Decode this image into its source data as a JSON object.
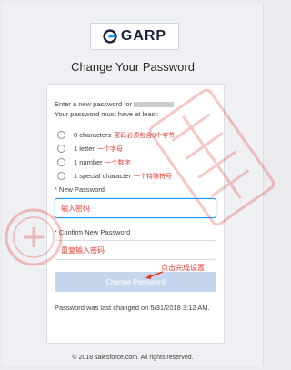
{
  "brand": {
    "logo_text": "GARP",
    "accent": "#1b96ff",
    "annotation_color": "#e23b2e"
  },
  "page": {
    "title": "Change Your Password"
  },
  "intro": {
    "line1": "Enter a new password for",
    "line2": "Your password must have at least:"
  },
  "requirements": [
    {
      "label": "8 characters",
      "note": "密码必须包含8个字节"
    },
    {
      "label": "1 letter",
      "note": "一个字母"
    },
    {
      "label": "1 number",
      "note": "一个数字"
    },
    {
      "label": "1 special character",
      "note": "一个特殊符号"
    }
  ],
  "fields": {
    "new_password": {
      "label": "New Password",
      "value": "输入密码"
    },
    "confirm_password": {
      "label": "Confirm New Password",
      "value": "重复输入密码"
    }
  },
  "button": {
    "label": "Change Password",
    "note": "点击完成设置"
  },
  "last_changed": "Password was last changed on 5/31/2018 3:12 AM.",
  "footer": "© 2018 salesforce.com. All rights reserved."
}
